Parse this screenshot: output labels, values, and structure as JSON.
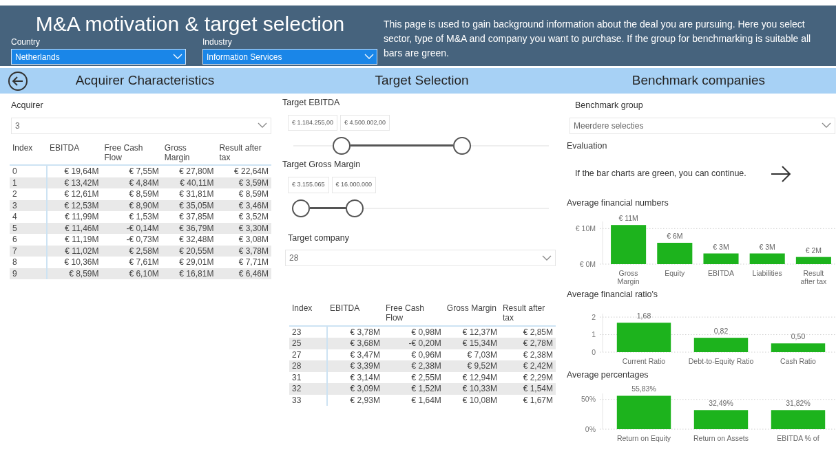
{
  "header": {
    "title": "M&A motivation & target selection",
    "description": "This page is used to gain background information about the deal you are pursuing.  Here you select sector, type of M&A and company you want to purchase. If the group for benchmarking is suitable all bars are green.",
    "filters": [
      {
        "label": "Country",
        "value": "Netherlands"
      },
      {
        "label": "Industry",
        "value": "Information Services"
      }
    ]
  },
  "sections": [
    {
      "title": "Acquirer Characteristics"
    },
    {
      "title": "Target Selection"
    },
    {
      "title": "Benchmark companies"
    }
  ],
  "acquirer": {
    "label": "Acquirer",
    "value": "3",
    "table": {
      "columns": [
        "Index",
        "EBITDA",
        "Free Cash Flow",
        "Gross Margin",
        "Result after tax"
      ],
      "rows": [
        [
          "0",
          "€ 19,64M",
          "€ 7,55M",
          "€ 27,80M",
          "€ 22,64M"
        ],
        [
          "1",
          "€ 13,42M",
          "€ 4,84M",
          "€ 40,11M",
          "€ 3,59M"
        ],
        [
          "2",
          "€ 12,61M",
          "€ 8,59M",
          "€ 31,81M",
          "€ 8,59M"
        ],
        [
          "3",
          "€ 12,53M",
          "€ 8,90M",
          "€ 35,05M",
          "€ 3,46M"
        ],
        [
          "4",
          "€ 11,99M",
          "€ 1,53M",
          "€ 37,85M",
          "€ 3,52M"
        ],
        [
          "5",
          "€ 11,46M",
          "-€ 0,14M",
          "€ 36,79M",
          "€ 3,30M"
        ],
        [
          "6",
          "€ 11,19M",
          "-€ 0,73M",
          "€ 32,48M",
          "€ 3,08M"
        ],
        [
          "7",
          "€ 11,02M",
          "€ 2,58M",
          "€ 20,55M",
          "€ 3,78M"
        ],
        [
          "8",
          "€ 10,36M",
          "€ 7,61M",
          "€ 29,01M",
          "€ 7,71M"
        ],
        [
          "9",
          "€ 8,59M",
          "€ 6,10M",
          "€ 16,81M",
          "€ 6,46M"
        ]
      ]
    }
  },
  "target": {
    "sliders": [
      {
        "label": "Target EBITDA",
        "min_text": "€ 1.184.255,00",
        "max_text": "€ 4.500.002,00"
      },
      {
        "label": "Target Gross Margin",
        "min_text": "€ 3.155.065",
        "max_text": "€ 16.000.000"
      }
    ],
    "company": {
      "label": "Target company",
      "value": "28"
    },
    "table": {
      "columns": [
        "Index",
        "EBITDA",
        "Free Cash Flow",
        "Gross Margin",
        "Result after tax"
      ],
      "rows": [
        [
          "23",
          "€ 3,78M",
          "€ 0,98M",
          "€ 12,37M",
          "€ 2,85M"
        ],
        [
          "25",
          "€ 3,68M",
          "-€ 0,20M",
          "€ 15,34M",
          "€ 2,78M"
        ],
        [
          "27",
          "€ 3,47M",
          "€ 0,96M",
          "€ 7,03M",
          "€ 2,38M"
        ],
        [
          "28",
          "€ 3,39M",
          "€ 2,38M",
          "€ 9,52M",
          "€ 2,42M"
        ],
        [
          "31",
          "€ 3,14M",
          "€ 2,55M",
          "€ 12,94M",
          "€ 2,29M"
        ],
        [
          "32",
          "€ 3,09M",
          "€ 1,52M",
          "€ 10,33M",
          "€ 1,54M"
        ],
        [
          "33",
          "€ 2,93M",
          "€ 1,64M",
          "€ 10,08M",
          "€ 1,67M"
        ]
      ]
    }
  },
  "benchmark": {
    "group": {
      "label": "Benchmark group",
      "value": "Meerdere selecties"
    },
    "evaluation": {
      "title": "Evaluation",
      "text": "If the bar charts are green, you can continue."
    },
    "charts": [
      {
        "title": "Average financial numbers",
        "chart_data": {
          "type": "bar",
          "categories": [
            "Gross Margin",
            "Equity",
            "EBITDA",
            "Liabilities",
            "Result after tax"
          ],
          "series": [
            {
              "color": "#1db31d",
              "values": [
                11,
                6,
                3,
                3,
                2
              ]
            }
          ],
          "ylim": [
            0,
            12
          ],
          "yticks": [
            {
              "value": 0,
              "label": "€ 0M"
            },
            {
              "value": 10,
              "label": "€ 10M"
            }
          ],
          "value_labels": [
            "€ 11M",
            "€ 6M",
            "€ 3M",
            "€ 3M",
            "€ 2M"
          ]
        }
      },
      {
        "title": "Average financial ratio's",
        "chart_data": {
          "type": "bar",
          "categories": [
            "Current Ratio",
            "Debt-to-Equity Ratio",
            "Cash Ratio"
          ],
          "series": [
            {
              "color": "#1db31d",
              "values": [
                1.68,
                0.82,
                0.5
              ]
            }
          ],
          "ylim": [
            0,
            2.2
          ],
          "yticks": [
            {
              "value": 0,
              "label": "0"
            },
            {
              "value": 1,
              "label": "1"
            },
            {
              "value": 2,
              "label": "2"
            }
          ],
          "value_labels": [
            "1,68",
            "0,82",
            "0,50"
          ]
        }
      },
      {
        "title": "Average percentages",
        "chart_data": {
          "type": "bar",
          "categories": [
            "Return on Equity",
            "Return on Assets",
            "EBITDA % of"
          ],
          "series": [
            {
              "color": "#1db31d",
              "values": [
                56,
                32,
                32
              ]
            }
          ],
          "ylim": [
            0,
            60
          ],
          "yticks": [
            {
              "value": 0,
              "label": "0%"
            },
            {
              "value": 50,
              "label": "50%"
            }
          ],
          "value_labels": [
            "55,83%",
            "32,49%",
            "31,82%"
          ]
        }
      }
    ]
  }
}
